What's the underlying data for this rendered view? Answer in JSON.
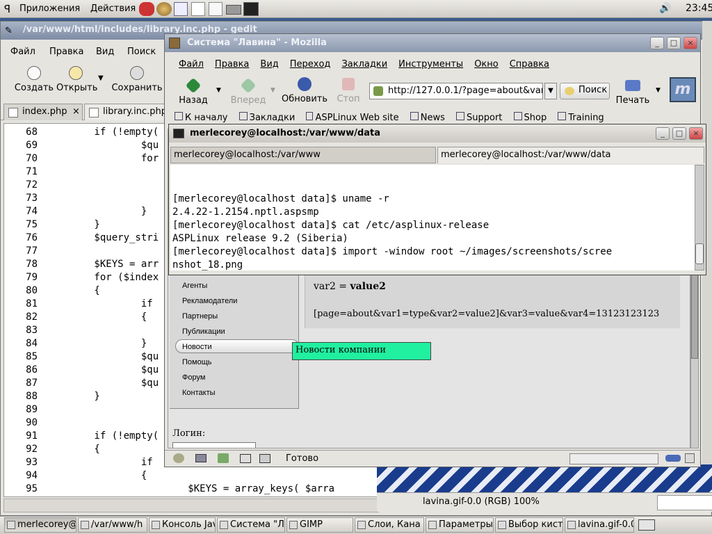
{
  "top_panel": {
    "apps_menu": "Приложения",
    "actions_menu": "Действия",
    "clock": "23:45",
    "launchers": [
      "mozilla-icon",
      "browser-icon",
      "notes-icon",
      "paint-icon",
      "doc-icon",
      "drive-icon",
      "terminal-icon"
    ]
  },
  "gedit": {
    "title": "/var/www/html/includes/library.inc.php - gedit",
    "menu": [
      "Файл",
      "Правка",
      "Вид",
      "Поиск"
    ],
    "toolbar": {
      "create": "Создать",
      "open": "Открыть",
      "save": "Сохранить"
    },
    "tabs": [
      "index.php",
      "library.inc.php"
    ],
    "lines": [
      {
        "n": "68",
        "t": "        if (!empty("
      },
      {
        "n": "69",
        "t": "                $qu"
      },
      {
        "n": "70",
        "t": "                for"
      },
      {
        "n": "71",
        "t": ""
      },
      {
        "n": "72",
        "t": ""
      },
      {
        "n": "73",
        "t": ""
      },
      {
        "n": "74",
        "t": "                }"
      },
      {
        "n": "75",
        "t": "        }"
      },
      {
        "n": "76",
        "t": "        $query_stri"
      },
      {
        "n": "77",
        "t": ""
      },
      {
        "n": "78",
        "t": "        $KEYS = arr"
      },
      {
        "n": "79",
        "t": "        for ($index"
      },
      {
        "n": "80",
        "t": "        {"
      },
      {
        "n": "81",
        "t": "                if"
      },
      {
        "n": "82",
        "t": "                {"
      },
      {
        "n": "83",
        "t": ""
      },
      {
        "n": "84",
        "t": "                }"
      },
      {
        "n": "85",
        "t": "                $qu"
      },
      {
        "n": "86",
        "t": "                $qu"
      },
      {
        "n": "87",
        "t": "                $qu"
      },
      {
        "n": "88",
        "t": "        }"
      },
      {
        "n": "89",
        "t": ""
      },
      {
        "n": "90",
        "t": ""
      },
      {
        "n": "91",
        "t": "        if (!empty("
      },
      {
        "n": "92",
        "t": "        {"
      },
      {
        "n": "93",
        "t": "                if"
      },
      {
        "n": "94",
        "t": "                {"
      },
      {
        "n": "95",
        "t": "                        $KEYS = array_keys( $arra"
      }
    ]
  },
  "mozilla": {
    "title": "Система \"Лавина\" - Mozilla",
    "menu": [
      "Файл",
      "Правка",
      "Вид",
      "Переход",
      "Закладки",
      "Инструменты",
      "Окно",
      "Справка"
    ],
    "toolbar": {
      "back": "Назад",
      "forward": "Вперед",
      "reload": "Обновить",
      "stop": "Стоп",
      "search": "Поиск",
      "print": "Печать"
    },
    "url": "http://127.0.0.1/?page=about&var",
    "bookmarks": [
      "К началу",
      "Закладки",
      "ASPLinux Web site",
      "News",
      "Support",
      "Shop",
      "Training"
    ],
    "nav_items": [
      "Агенты",
      "Рекламодатели",
      "Партнеры",
      "Публикации",
      "Новости",
      "Помощь",
      "Форум",
      "Контакты"
    ],
    "tooltip": "Новости компании",
    "var2_label": "var2 = ",
    "var2_value": "value2",
    "query_line": "[page=about&var1=type&var2=value2]&var3=value&var4=13123123123",
    "login_label": "Логин:",
    "status": "Готово"
  },
  "terminal": {
    "title": "merlecorey@localhost:/var/www/data",
    "tabs": [
      "merlecorey@localhost:/var/www",
      "merlecorey@localhost:/var/www/data"
    ],
    "lines": [
      "[merlecorey@localhost data]$ uname -r",
      "2.4.22-1.2154.nptl.aspsmp",
      "[merlecorey@localhost data]$ cat /etc/asplinux-release",
      "ASPLinux release 9.2 (Siberia)",
      "[merlecorey@localhost data]$ import -window root ~/images/screenshots/scree",
      "nshot_18.png"
    ]
  },
  "gimp": {
    "status": "lavina.gif-0.0 (RGB) 100%"
  },
  "taskbar": [
    "merlecorey@",
    "/var/www/h",
    "Консоль Jav",
    "Система \"Л",
    "GIMP",
    "Слои, Кана",
    "Параметры",
    "Выбор кисті",
    "lavina.gif-0.0"
  ]
}
